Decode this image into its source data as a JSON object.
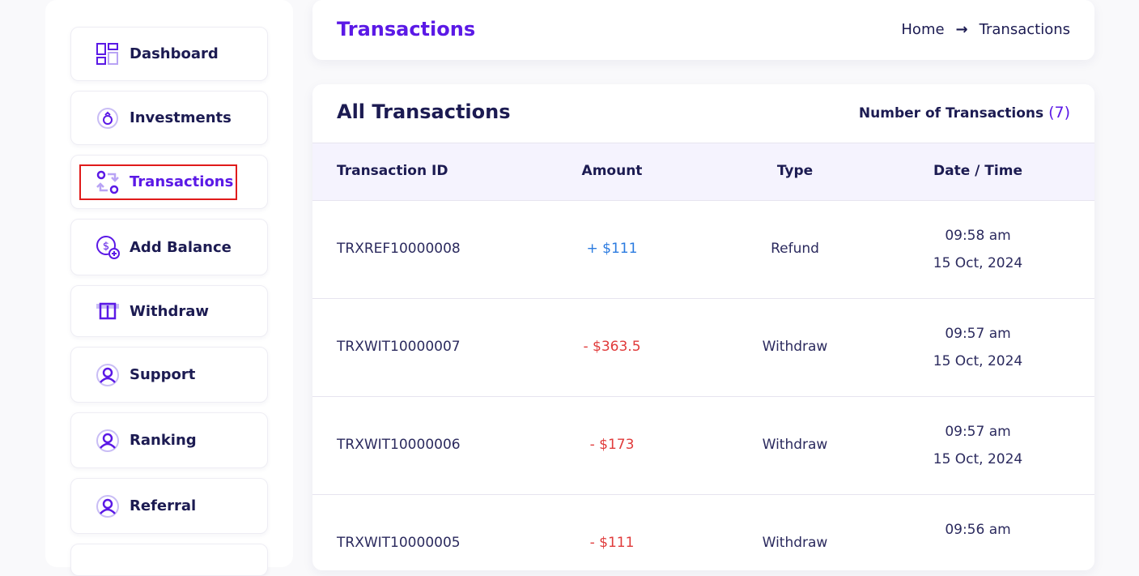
{
  "sidebar": {
    "items": [
      {
        "label": "Dashboard",
        "icon": "dashboard-icon"
      },
      {
        "label": "Investments",
        "icon": "investments-icon"
      },
      {
        "label": "Transactions",
        "icon": "transactions-icon",
        "active": true
      },
      {
        "label": "Add Balance",
        "icon": "add-balance-icon"
      },
      {
        "label": "Withdraw",
        "icon": "withdraw-icon"
      },
      {
        "label": "Support",
        "icon": "user-icon"
      },
      {
        "label": "Ranking",
        "icon": "user-icon"
      },
      {
        "label": "Referral",
        "icon": "user-icon"
      }
    ]
  },
  "header": {
    "title": "Transactions",
    "breadcrumb": {
      "home": "Home",
      "separator": "→",
      "current": "Transactions"
    }
  },
  "main": {
    "title": "All Transactions",
    "count_label": "Number of Transactions",
    "count_value": "(7)",
    "columns": [
      "Transaction ID",
      "Amount",
      "Type",
      "Date / Time"
    ],
    "rows": [
      {
        "id": "TRXREF10000008",
        "amount": "+ $111",
        "type": "Refund",
        "time": "09:58 am",
        "date": "15 Oct, 2024"
      },
      {
        "id": "TRXWIT10000007",
        "amount": "- $363.5",
        "type": "Withdraw",
        "time": "09:57 am",
        "date": "15 Oct, 2024"
      },
      {
        "id": "TRXWIT10000006",
        "amount": "- $173",
        "type": "Withdraw",
        "time": "09:57 am",
        "date": "15 Oct, 2024"
      },
      {
        "id": "TRXWIT10000005",
        "amount": "- $111",
        "type": "Withdraw",
        "time": "09:56 am",
        "date": ""
      }
    ]
  },
  "colors": {
    "accent": "#5b19e6",
    "positive": "#2b7be0",
    "negative": "#e03b3b",
    "highlight_box": "#e01b1b"
  }
}
